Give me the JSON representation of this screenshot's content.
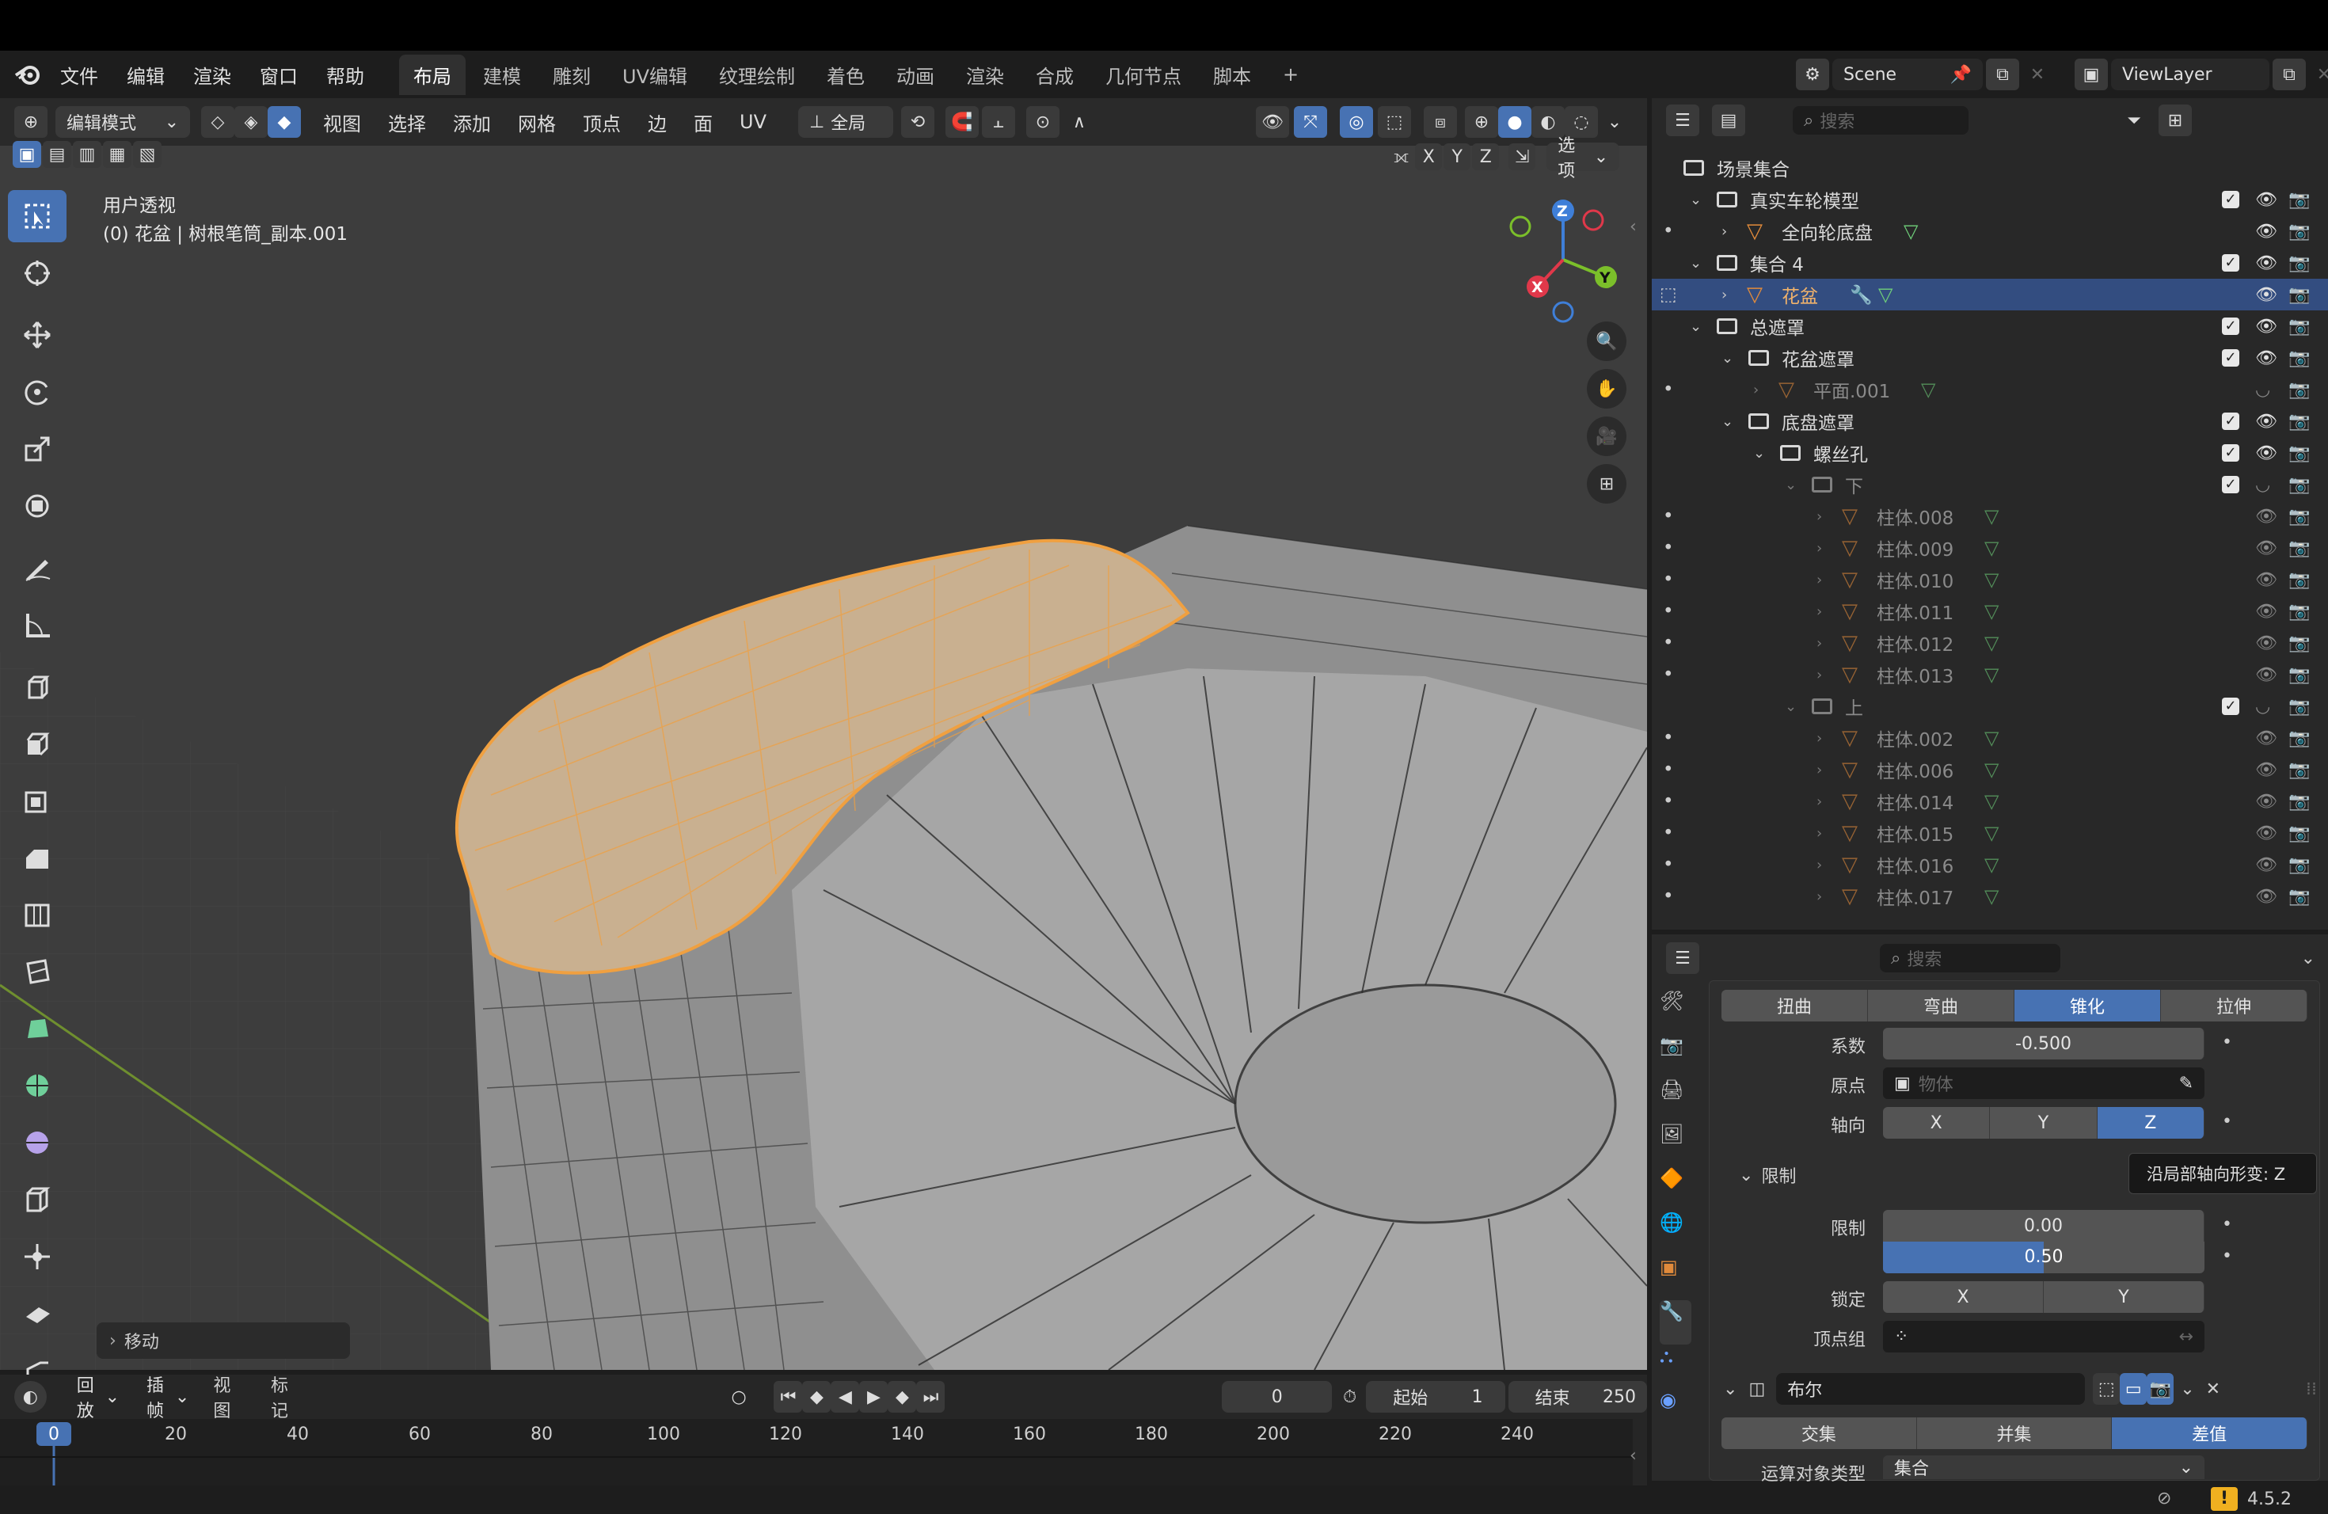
{
  "menus": [
    "文件",
    "编辑",
    "渲染",
    "窗口",
    "帮助"
  ],
  "workspaces": [
    "布局",
    "建模",
    "雕刻",
    "UV编辑",
    "纹理绘制",
    "着色",
    "动画",
    "渲染",
    "合成",
    "几何节点",
    "脚本",
    "+"
  ],
  "scene": {
    "name": "Scene",
    "layer": "ViewLayer"
  },
  "viewport": {
    "mode": "编辑模式",
    "menus": [
      "视图",
      "选择",
      "添加",
      "网格",
      "顶点",
      "边",
      "面",
      "UV"
    ],
    "orientation": "全局",
    "view_name": "用户透视",
    "object_name": "(0) 花盆 | 树根笔筒_副本.001",
    "axes": [
      "X",
      "Y",
      "Z"
    ],
    "options": "选项",
    "last_op": "移动"
  },
  "gizmo": {
    "x": "X",
    "y": "Y",
    "z": "Z"
  },
  "outliner": {
    "search_placeholder": "搜索",
    "rows": [
      {
        "name": "场景集合"
      },
      {
        "name": "真实车轮模型"
      },
      {
        "name": "全向轮底盘"
      },
      {
        "name": "集合 4"
      },
      {
        "name": "花盆"
      },
      {
        "name": "总遮罩"
      },
      {
        "name": "花盆遮罩"
      },
      {
        "name": "平面.001"
      },
      {
        "name": "底盘遮罩"
      },
      {
        "name": "螺丝孔"
      },
      {
        "name": "下"
      },
      {
        "name": "柱体.008"
      },
      {
        "name": "柱体.009"
      },
      {
        "name": "柱体.010"
      },
      {
        "name": "柱体.011"
      },
      {
        "name": "柱体.012"
      },
      {
        "name": "柱体.013"
      },
      {
        "name": "上"
      },
      {
        "name": "柱体.002"
      },
      {
        "name": "柱体.006"
      },
      {
        "name": "柱体.014"
      },
      {
        "name": "柱体.015"
      },
      {
        "name": "柱体.016"
      },
      {
        "name": "柱体.017"
      }
    ]
  },
  "properties": {
    "search_placeholder": "搜索",
    "deform_tabs": [
      "扭曲",
      "弯曲",
      "锥化",
      "拉伸"
    ],
    "factor_label": "系数",
    "factor_value": "-0.500",
    "origin_label": "原点",
    "origin_placeholder": "物体",
    "axis_label": "轴向",
    "axis_options": [
      "X",
      "Y",
      "Z"
    ],
    "tooltip": "沿局部轴向形变: Z",
    "limits_header": "限制",
    "limits_label": "限制",
    "limit_min": "0.00",
    "limit_max": "0.50",
    "lock_label": "锁定",
    "lock_options": [
      "X",
      "Y"
    ],
    "vgroup_label": "顶点组",
    "boolean_name": "布尔",
    "bool_ops": [
      "交集",
      "并集",
      "差值"
    ],
    "operand_label": "运算对象类型",
    "operand_value": "集合"
  },
  "timeline": {
    "menus": [
      "回放",
      "插帧",
      "视图",
      "标记"
    ],
    "current_frame": "0",
    "start_label": "起始",
    "start": "1",
    "end_label": "结束",
    "end": "250",
    "ticks": [
      "0",
      "20",
      "40",
      "60",
      "80",
      "100",
      "120",
      "140",
      "160",
      "180",
      "200",
      "220",
      "240"
    ]
  },
  "status": {
    "version": "4.5.2"
  },
  "colors": {
    "accent": "#4772b3",
    "selected_orange": "#f0a040",
    "mesh_icon": "#e08a3b",
    "data_icon": "#6fd07a"
  }
}
